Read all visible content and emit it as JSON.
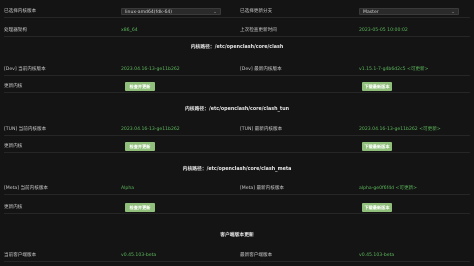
{
  "top": {
    "current_kernel_label": "已选择内核版本",
    "current_kernel_value": "linux-amd64(fdk-64)",
    "selected_branch_label": "已选择更新分支",
    "selected_branch_value": "Master",
    "arch_label": "处理器架构",
    "arch_value": "x86_64",
    "last_check_label": "上次检查更新时间",
    "last_check_value": "2023-05-05 10:00:02"
  },
  "sections": [
    {
      "path_label": "内核路径：/etc/openclash/core/clash",
      "current_label": "[Dev] 当前内核版本",
      "current_value": "2023.04.16-13-ge11b262",
      "latest_label": "[Dev] 最新内核版本",
      "latest_value": "v1.15.1-7-g4b6d2c5 <可更新>",
      "update_label": "更新内核",
      "check_button": "检查并更新",
      "download_button": "下载最新版本"
    },
    {
      "path_label": "内核路径：/etc/openclash/core/clash_tun",
      "current_label": "[TUN] 当前内核版本",
      "current_value": "2023.04.16-13-ge11b262",
      "latest_label": "[TUN] 最新内核版本",
      "latest_value": "2023.04.16-13-ge11b262 <可更新>",
      "update_label": "更新内核",
      "check_button": "检查并更新",
      "download_button": "下载最新版本"
    },
    {
      "path_label": "内核路径：/etc/openclash/core/clash_meta",
      "current_label": "[Meta] 当前内核版本",
      "current_value": "Alpha",
      "latest_label": "[Meta] 最新内核版本",
      "latest_value": "alpha-ge0f6f4d <可更新>",
      "update_label": "更新内核",
      "check_button": "检查并更新",
      "download_button": "下载最新版本"
    }
  ],
  "client": {
    "heading": "客户端版本更新",
    "current_label": "当前客户端版本",
    "current_value": "v0.45.103-beta",
    "latest_label": "最新客户端版本",
    "latest_value": "v0.45.103-beta"
  }
}
